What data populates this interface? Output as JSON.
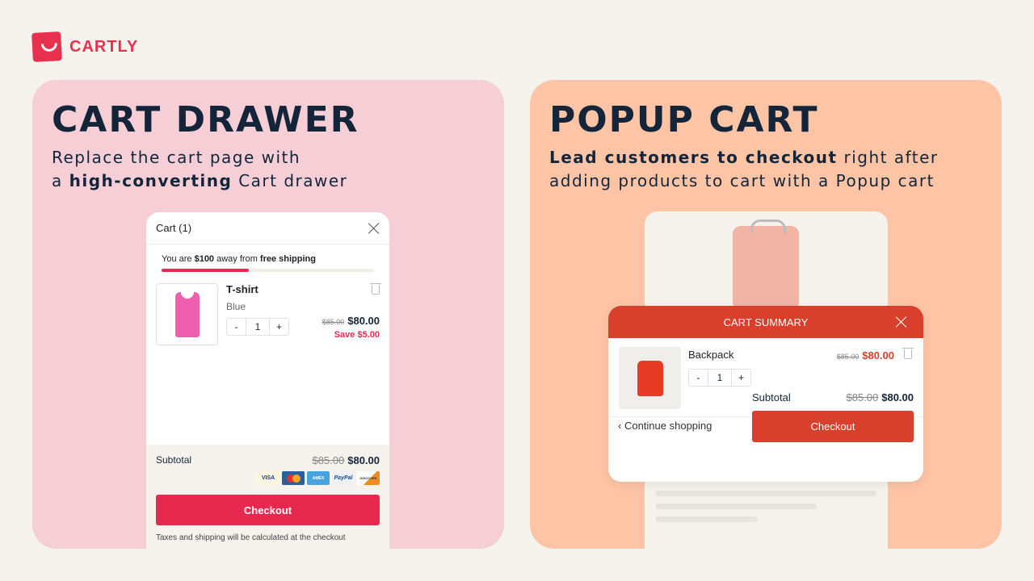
{
  "brand": {
    "name": "CARTLY",
    "color": "#e8314f"
  },
  "left": {
    "title": "CART DRAWER",
    "subtitle": {
      "pre": "Replace the cart page with",
      "line2_pre": "a ",
      "bold": "high-converting",
      "post": " Cart drawer"
    },
    "drawer": {
      "header": "Cart (1)",
      "shipping": {
        "pre": "You are ",
        "amount": "$100",
        "mid": " away from ",
        "bold": "free shipping",
        "progress_percent": 41
      },
      "item": {
        "name": "T-shirt",
        "variant": "Blue",
        "qty_minus": "-",
        "qty": "1",
        "qty_plus": "+",
        "old_price": "$85.00",
        "price": "$80.00",
        "save": "Save $5.00"
      },
      "subtotal_label": "Subtotal",
      "subtotal_old": "$85.00",
      "subtotal": "$80.00",
      "payment_methods": [
        "VISA",
        "MasterCard",
        "AMEX",
        "PayPal",
        "DISCOVER"
      ],
      "checkout": "Checkout",
      "tax_note": "Taxes and shipping will be calculated at the checkout"
    }
  },
  "right": {
    "title": "POPUP CART",
    "subtitle": {
      "bold": "Lead customers to checkout",
      "post": " right after",
      "line2": "adding products to cart with a Popup cart"
    },
    "popup": {
      "header": "CART SUMMARY",
      "item": {
        "name": "Backpack",
        "qty_minus": "-",
        "qty": "1",
        "qty_plus": "+",
        "old_price": "$85.00",
        "price": "$80.00"
      },
      "subtotal_label": "Subtotal",
      "subtotal_old": "$85.00",
      "subtotal": "$80.00",
      "continue": "Continue shopping",
      "checkout": "Checkout"
    }
  }
}
